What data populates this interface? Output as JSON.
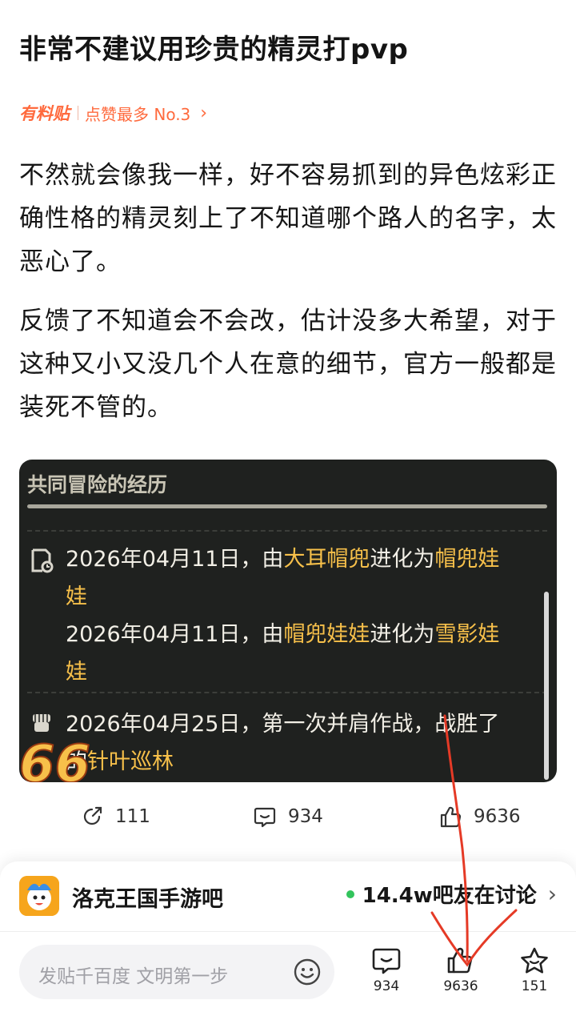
{
  "post": {
    "title": "非常不建议用珍贵的精灵打pvp",
    "badge": "有料贴",
    "rank": "点赞最多 No.3",
    "paragraphs": [
      "不然就会像我一样，好不容易抓到的异色炫彩正确性格的精灵刻上了不知道哪个路人的名字，太恶心了。",
      "反馈了不知道会不会改，估计没多大希望，对于这种又小又没几个人在意的细节，官方一般都是装死不管的。"
    ]
  },
  "screenshot": {
    "header": "共同冒险的经历",
    "entry1": {
      "line1_prefix": "2026年04月11日，由",
      "line1_a": "大耳帽兜",
      "line1_mid": "进化为",
      "line1_b": "帽兜娃",
      "line1_wrap": "娃",
      "line2_prefix": "2026年04月11日，由",
      "line2_a": "帽兜娃娃",
      "line2_mid": "进化为",
      "line2_b": "雪影娃",
      "line2_wrap": "娃"
    },
    "entry2": {
      "line1": "2026年04月25日，第一次并肩作战，战胜了",
      "line2_prefix": "的",
      "line2_hl": "针叶巡林"
    },
    "sticker_text": "66"
  },
  "stats": {
    "share": "111",
    "comments": "934",
    "likes": "9636"
  },
  "forum": {
    "name": "洛克王国手游吧",
    "online": "14.4w吧友在讨论"
  },
  "composer": {
    "placeholder": "发贴千百度 文明第一步"
  },
  "actions": {
    "comments": "934",
    "likes": "9636",
    "favorites": "151"
  },
  "colors": {
    "accent": "#ff6a3d",
    "highlight": "#f7c04a",
    "annotation": "#e53a26",
    "online": "#32c45c"
  }
}
